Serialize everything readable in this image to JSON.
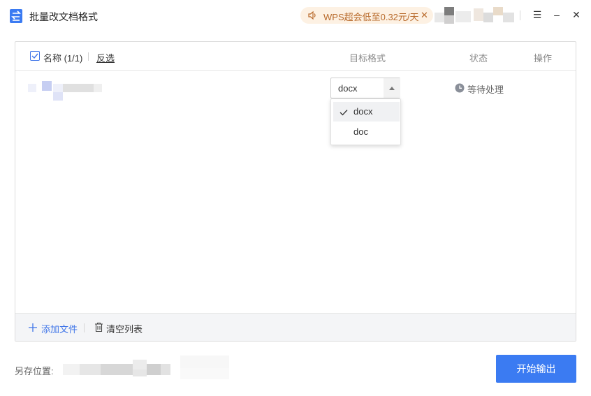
{
  "app": {
    "title": "批量改文档格式",
    "icon": "batch-convert-icon",
    "accent": "#3b7bf2"
  },
  "promo": {
    "text": "WPS超会低至0.32元/天",
    "close": "✕",
    "icon": "speaker-icon",
    "background": "#fdf1e3",
    "color": "#b86a2b"
  },
  "window_controls": {
    "menu": "☰",
    "minimize": "–",
    "close": "✕"
  },
  "table": {
    "header": {
      "name": "名称 (1/1)",
      "invert": "反选",
      "format": "目标格式",
      "status": "状态",
      "action": "操作",
      "select_all_checked": true
    },
    "rows": [
      {
        "filename_redacted": true,
        "format": "docx",
        "status": "等待处理",
        "status_icon": "clock-icon"
      }
    ],
    "footer": {
      "add_file": "添加文件",
      "clear_list": "清空列表"
    }
  },
  "dropdown": {
    "options": [
      {
        "label": "docx",
        "selected": true
      },
      {
        "label": "doc",
        "selected": false
      }
    ]
  },
  "bottom": {
    "save_location_label": "另存位置:",
    "save_path_redacted": true,
    "start_button": "开始输出"
  }
}
